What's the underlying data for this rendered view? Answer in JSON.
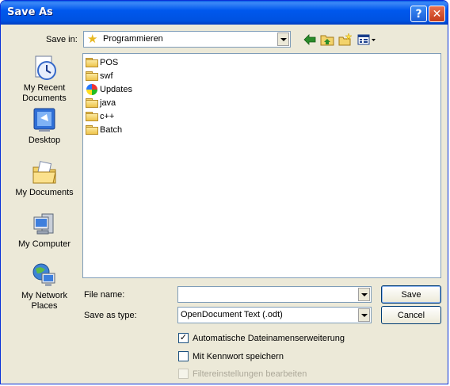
{
  "window": {
    "title": "Save As",
    "help_glyph": "?",
    "close_glyph": "✕"
  },
  "save_in": {
    "label": "Save in:",
    "value": "Programmieren",
    "icon": "star-folder-icon"
  },
  "toolbar": {
    "back_icon": "back-arrow-icon",
    "up_icon": "up-folder-icon",
    "new_folder_icon": "new-folder-icon",
    "view_icon": "view-menu-icon"
  },
  "places": [
    {
      "line1": "My Recent",
      "line2": "Documents",
      "icon": "recent-documents-icon"
    },
    {
      "line1": "Desktop",
      "line2": "",
      "icon": "desktop-icon"
    },
    {
      "line1": "My Documents",
      "line2": "",
      "icon": "my-documents-icon"
    },
    {
      "line1": "My Computer",
      "line2": "",
      "icon": "my-computer-icon"
    },
    {
      "line1": "My Network",
      "line2": "Places",
      "icon": "network-places-icon"
    }
  ],
  "files": [
    {
      "name": "POS",
      "icon": "folder-icon"
    },
    {
      "name": "swf",
      "icon": "folder-icon"
    },
    {
      "name": "Updates",
      "icon": "globe-icon"
    },
    {
      "name": "java",
      "icon": "folder-icon"
    },
    {
      "name": "c++",
      "icon": "folder-icon"
    },
    {
      "name": "Batch",
      "icon": "folder-icon"
    }
  ],
  "form": {
    "filename_label": "File name:",
    "filename_value": "",
    "type_label": "Save as type:",
    "type_value": "OpenDocument Text (.odt)",
    "save_label": "Save",
    "cancel_label": "Cancel"
  },
  "options": [
    {
      "label": "Automatische Dateinamenserweiterung",
      "checked": true,
      "disabled": false
    },
    {
      "label": "Mit Kennwort speichern",
      "checked": false,
      "disabled": false
    },
    {
      "label": "Filtereinstellungen bearbeiten",
      "checked": false,
      "disabled": true
    }
  ],
  "colors": {
    "titlebar": "#0058ee",
    "dialog_bg": "#ece9d8",
    "field_border": "#7f9db9"
  }
}
